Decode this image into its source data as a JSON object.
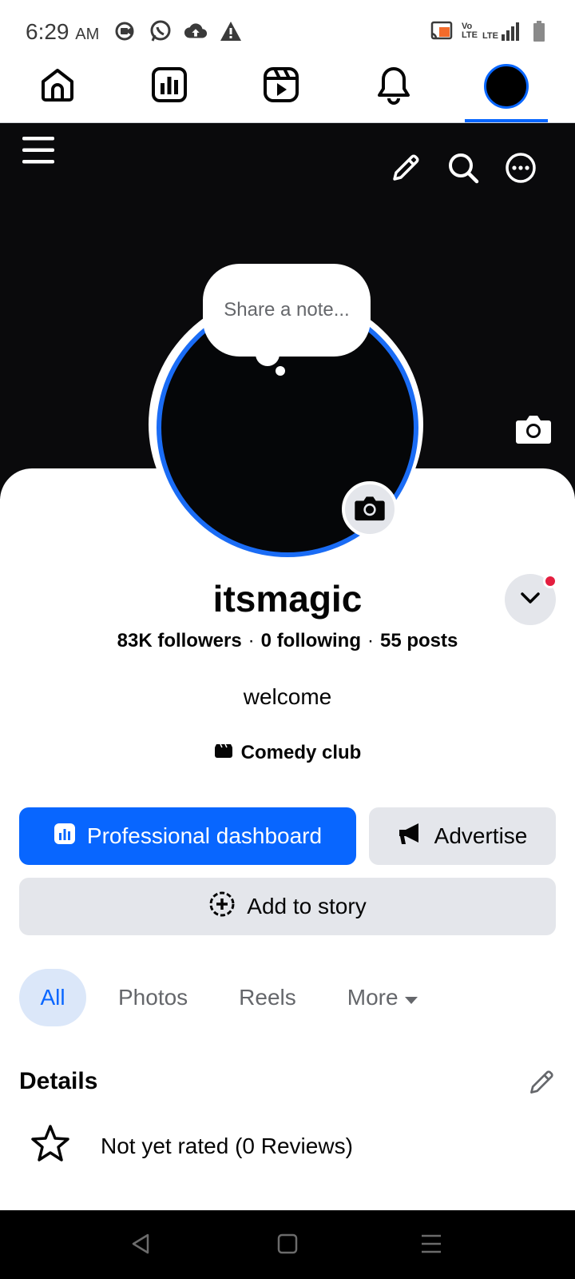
{
  "status_bar": {
    "time": "6:29",
    "ampm": "AM",
    "left_icons": [
      "screen-record-icon",
      "whatsapp-icon",
      "cloud-upload-icon",
      "warning-icon"
    ],
    "right_icons": [
      "cast-icon",
      "volte-icon",
      "lte-signal-icon",
      "battery-icon"
    ],
    "volte_label": "Vo LTE",
    "lte_label": "LTE"
  },
  "top_nav": {
    "items": [
      "home-icon",
      "dashboard-icon",
      "reels-icon",
      "notifications-icon",
      "profile-avatar"
    ],
    "active": "profile-avatar"
  },
  "cover": {
    "menu_icon": "hamburger-menu-icon",
    "actions": [
      "edit-pencil-icon",
      "search-icon",
      "more-options-icon"
    ],
    "camera_icon": "camera-icon"
  },
  "note": {
    "placeholder": "Share a note..."
  },
  "profile": {
    "name": "itsmagic",
    "followers": "83K followers",
    "following": "0 following",
    "posts": "55 posts",
    "separator": "·",
    "bio": "welcome",
    "category": "Comedy club"
  },
  "buttons": {
    "professional_dashboard": "Professional dashboard",
    "advertise": "Advertise",
    "add_to_story": "Add to story"
  },
  "tabs": [
    {
      "label": "All",
      "active": true
    },
    {
      "label": "Photos",
      "active": false
    },
    {
      "label": "Reels",
      "active": false
    },
    {
      "label": "More",
      "active": false
    }
  ],
  "details": {
    "title": "Details",
    "rating": "Not yet rated (0 Reviews)"
  },
  "colors": {
    "accent": "#0866ff",
    "notification_dot": "#e41e3f",
    "secondary_button": "#e4e6eb",
    "cover_bg": "#0a0a0c"
  }
}
